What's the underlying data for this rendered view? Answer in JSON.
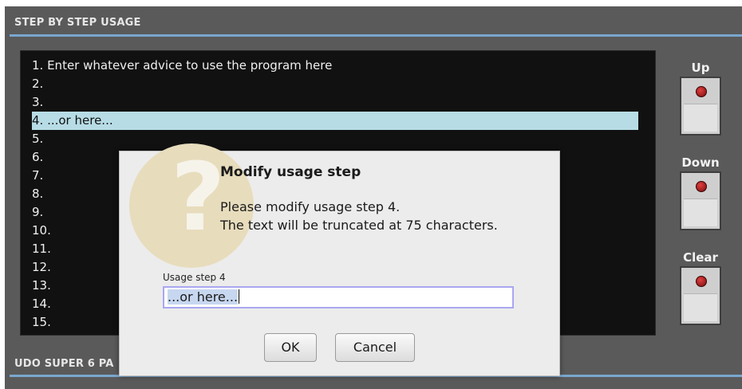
{
  "section": {
    "title": "STEP BY STEP USAGE",
    "bottom_title": "UDO SUPER 6 PA"
  },
  "steps": [
    "1. Enter whatever advice to use the program here",
    "2.",
    "3.",
    "4. ...or here...",
    "5.",
    "6.",
    "7.",
    "8.",
    "9.",
    "10.",
    "11.",
    "12.",
    "13.",
    "14.",
    "15."
  ],
  "selected_step_index": 3,
  "side_buttons": {
    "up": "Up",
    "down": "Down",
    "clear": "Clear"
  },
  "dialog": {
    "title": "Modify usage step",
    "message_line1": "Please modify usage step 4.",
    "message_line2": "The text will be truncated at 75 characters.",
    "field_label": "Usage step 4",
    "field_value": "...or here...",
    "ok_label": "OK",
    "cancel_label": "Cancel",
    "icon": "question-icon"
  },
  "colors": {
    "panel_bg": "#5a5a5a",
    "accent_rule": "#7aa7cf",
    "selected_row": "#b7dce6",
    "led": "#c01a1a"
  }
}
